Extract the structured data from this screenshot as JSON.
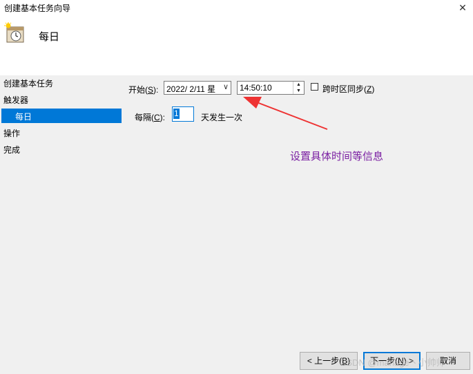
{
  "window": {
    "title": "创建基本任务向导",
    "close_glyph": "✕"
  },
  "header": {
    "title": "每日",
    "icon": "clock-calendar-icon"
  },
  "sidebar": {
    "items": [
      {
        "label": "创建基本任务"
      },
      {
        "label": "触发器"
      },
      {
        "label": "每日",
        "selected": true
      },
      {
        "label": "操作"
      },
      {
        "label": "完成"
      }
    ]
  },
  "form": {
    "start_label_prefix": "开始(",
    "start_label_key": "S",
    "start_label_suffix": "):",
    "date_value": "2022/ 2/11 星",
    "time_value": "14:50:10",
    "sync_label_prefix": "跨时区同步(",
    "sync_label_key": "Z",
    "sync_label_suffix": ")",
    "sync_checked": false,
    "recur_label_prefix": "每隔(",
    "recur_label_key": "C",
    "recur_label_suffix": "):",
    "recur_value": "1",
    "recur_unit": "天发生一次"
  },
  "annotation": {
    "text": "设置具体时间等信息",
    "color": "#7a1fa2",
    "arrow_color": "#ee3333"
  },
  "buttons": {
    "back_prefix": "< 上一步(",
    "back_key": "B",
    "back_suffix": ")",
    "next_prefix": "下一步(",
    "next_key": "N",
    "next_suffix": ") >",
    "cancel": "取消"
  },
  "watermark": "CSDN @manage丶小帅帅",
  "colors": {
    "accent": "#0078d7",
    "panel_bg": "#f0f0f0"
  }
}
